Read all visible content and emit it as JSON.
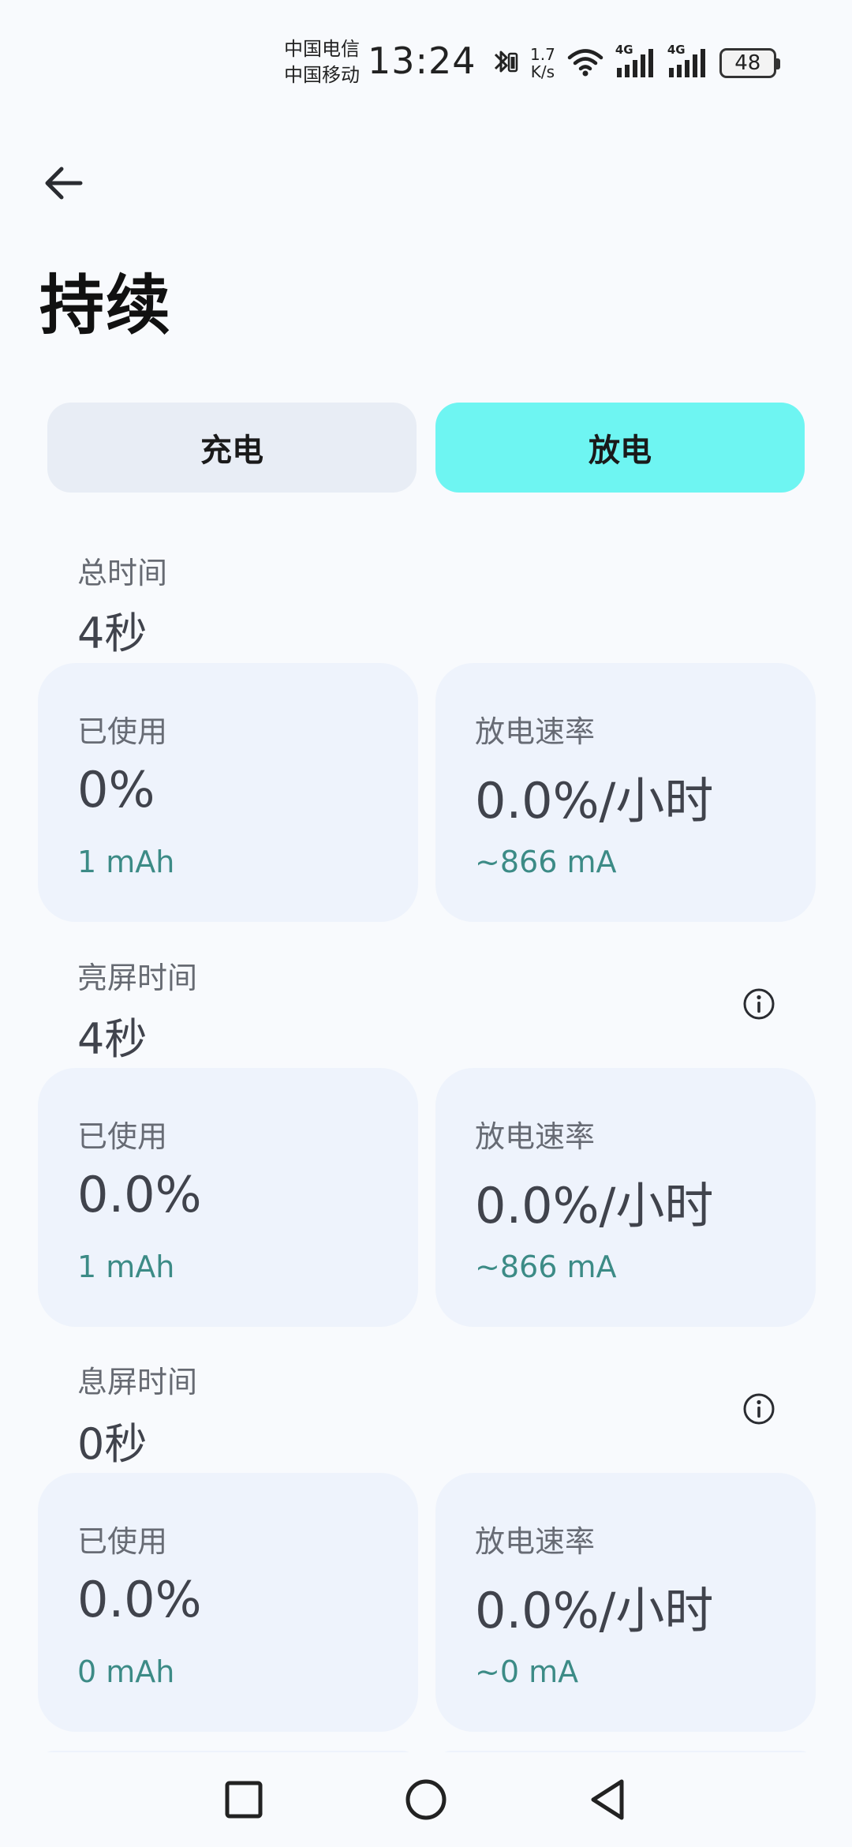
{
  "status_bar": {
    "carrier1": "中国电信",
    "carrier2": "中国移动",
    "time": "13:24",
    "speed_value": "1.7",
    "speed_unit": "K/s",
    "signal1_label": "4G",
    "signal2_label": "4G",
    "battery": "48"
  },
  "header": {
    "back_icon": "arrow-left-icon",
    "title": "持续"
  },
  "tabs": [
    {
      "label": "充电",
      "selected": false
    },
    {
      "label": "放电",
      "selected": true
    }
  ],
  "sections": [
    {
      "label": "总时间",
      "value": "4秒",
      "has_info": false,
      "used_label": "已使用",
      "used_value": "0%",
      "used_sub": "1 mAh",
      "rate_label": "放电速率",
      "rate_value": "0.0%/小时",
      "rate_sub": "~866 mA"
    },
    {
      "label": "亮屏时间",
      "value": "4秒",
      "has_info": true,
      "used_label": "已使用",
      "used_value": "0.0%",
      "used_sub": "1 mAh",
      "rate_label": "放电速率",
      "rate_value": "0.0%/小时",
      "rate_sub": "~866 mA"
    },
    {
      "label": "息屏时间",
      "value": "0秒",
      "has_info": true,
      "used_label": "已使用",
      "used_value": "0.0%",
      "used_sub": "0 mAh",
      "rate_label": "放电速率",
      "rate_value": "0.0%/小时",
      "rate_sub": "~0 mA"
    }
  ],
  "colors": {
    "selected_tab": "#6ef5f2",
    "unselected_tab": "#e8edf5",
    "card_bg": "#eef3fc",
    "accent_text": "#3c8b86"
  },
  "nav": {
    "recent_icon": "square-icon",
    "home_icon": "circle-icon",
    "back_icon": "triangle-back-icon"
  }
}
